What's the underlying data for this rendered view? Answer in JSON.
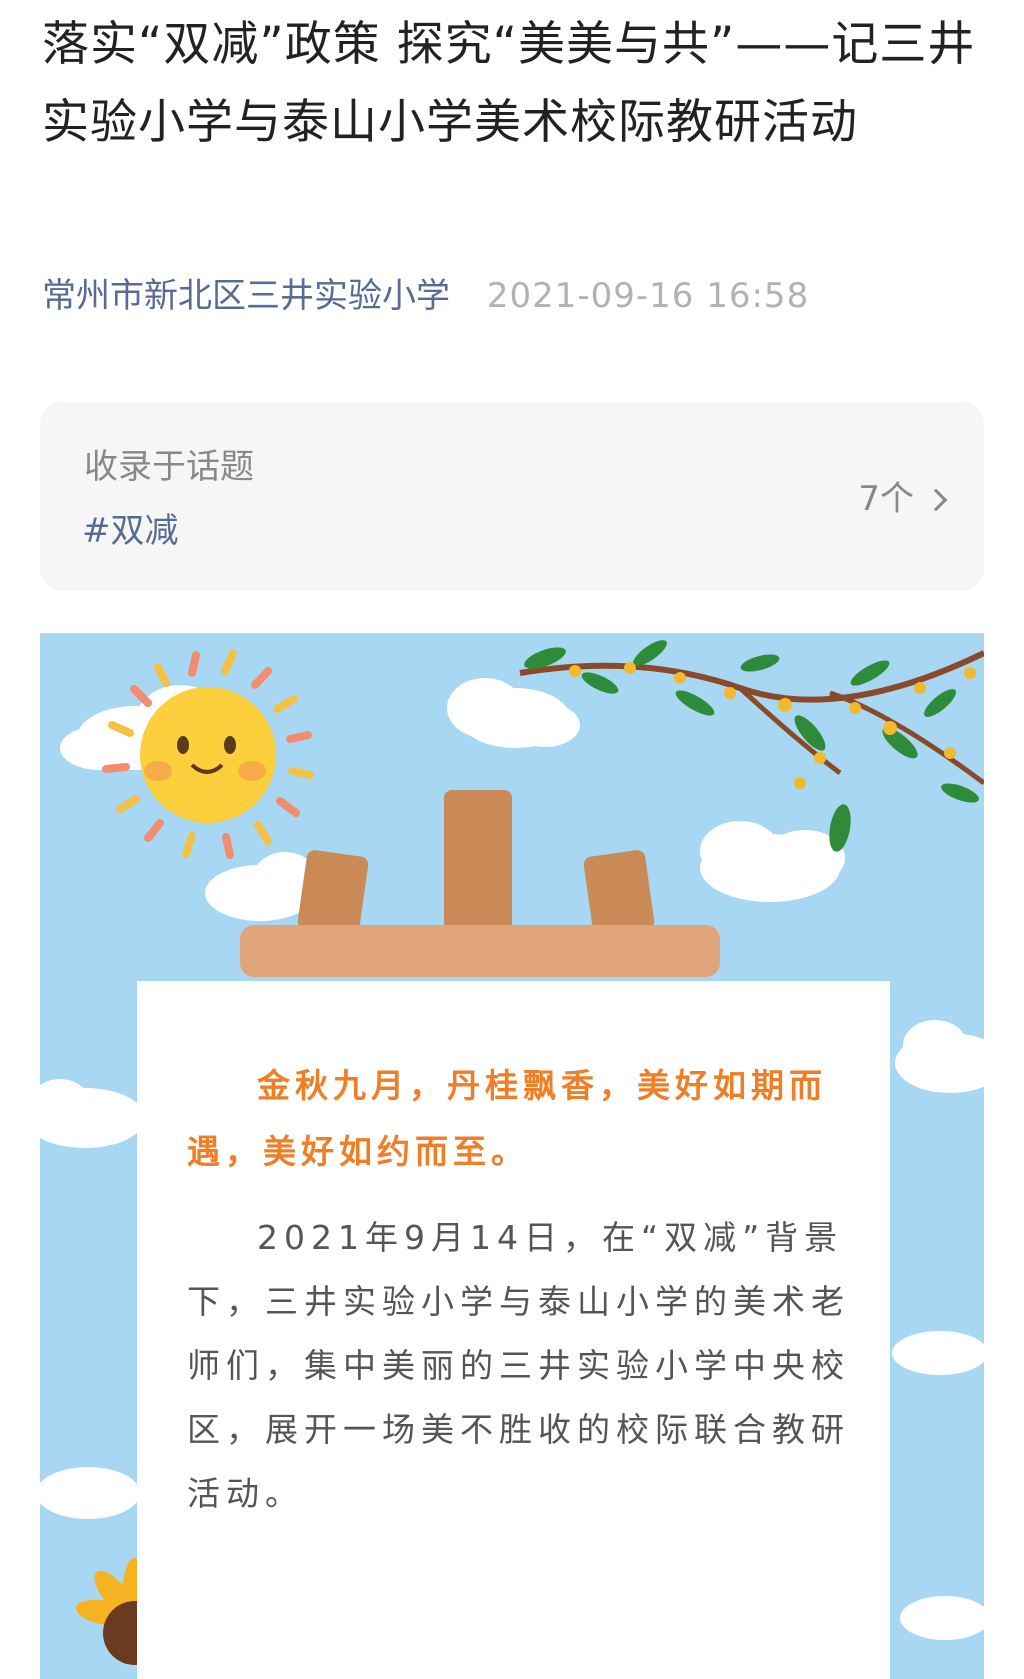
{
  "article": {
    "title": "落实“双减”政策 探究“美美与共”——记三井实验小学与泰山小学美术校际教研活动",
    "author": "常州市新北区三井实验小学",
    "date": "2021-09-16 16:58"
  },
  "topic": {
    "label": "收录于话题",
    "tag": "#双减",
    "count": "7个"
  },
  "poster": {
    "lead": "金秋九月，丹桂飘香，美好如期而遇，美好如约而至。",
    "paragraph": "2021年9月14日，在“双减”背景下，三井实验小学与泰山小学的美术老师们，集中美丽的三井实验小学中央校区，展开一场美不胜收的校际联合教研活动。"
  },
  "colors": {
    "title": "#222222",
    "link": "#576b95",
    "meta_gray": "#b2b2b2",
    "sky": "#a7d7f3",
    "lead_orange": "#ef7e26",
    "easel_brown": "#c98a58"
  }
}
